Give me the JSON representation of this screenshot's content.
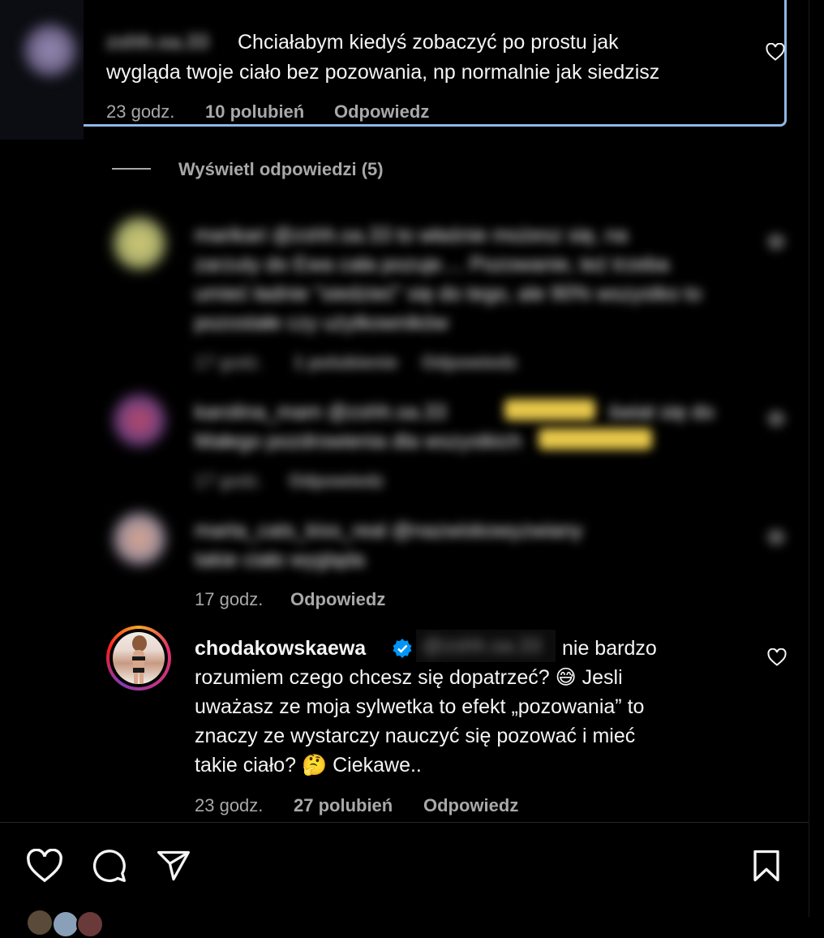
{
  "top_comment": {
    "username_blurred": "zshh.sa.33",
    "text_line1": "Chciałabym kiedyś zobaczyć po prostu jak",
    "text_line2": "wygląda twoje ciało bez pozowania, np normalnie jak siedzisz",
    "time": "23 godz.",
    "likes": "10 polubień",
    "reply": "Odpowiedz"
  },
  "view_replies": "Wyświetl odpowiedzi (5)",
  "blurred_replies": [
    {
      "line1": "marikari @zshh.sa.33 to właśnie możesz się, na",
      "line2": "zarzuty do Ewa cała pozuje.... Pozowanie, też trzeba",
      "line3": "umieć ładnie \"siedzieć\" się do tego, ale 90% wszystko to",
      "line4": "pozostałe czy użytkowników",
      "time": "17 godz.",
      "likes": "1 polubienie",
      "reply": "Odpowiedz"
    },
    {
      "line1": "karolina_mam @zshh.sa.33",
      "line1b": "świat się do",
      "line2": "Małego pozdrowienia dla wszystkich",
      "time": "17 godz.",
      "reply": "Odpowiedz"
    },
    {
      "line1": "marta_cats_kiss_real @nazwiskowyzwiany",
      "line2": "takie ciało wygląda",
      "time": "17 godz.",
      "reply": "Odpowiedz"
    }
  ],
  "main_reply": {
    "username": "chodakowskaewa",
    "mention_blurred": "@zshh.sa.33",
    "text_line1": "nie bardzo",
    "text_line2": "rozumiem czego chcesz się dopatrzeć? 😅 Jesli",
    "text_line3": "uważasz ze moja sylwetka to efekt „pozowania” to",
    "text_line4": "znaczy ze wystarczy nauczyć się pozować i mieć",
    "text_line5": "takie ciało? 🤔 Ciekawe..",
    "time": "23 godz.",
    "likes": "27 polubień",
    "reply": "Odpowiedz"
  },
  "colors": {
    "background": "#000000",
    "text": "#f5f5f5",
    "muted": "#a8a8a8",
    "verified": "#0095f6",
    "highlight_border": "#8fb8e8"
  },
  "icons": {
    "like": "heart-icon",
    "comment": "comment-icon",
    "share": "paper-plane-icon",
    "save": "bookmark-icon",
    "verified": "verified-badge-icon"
  }
}
